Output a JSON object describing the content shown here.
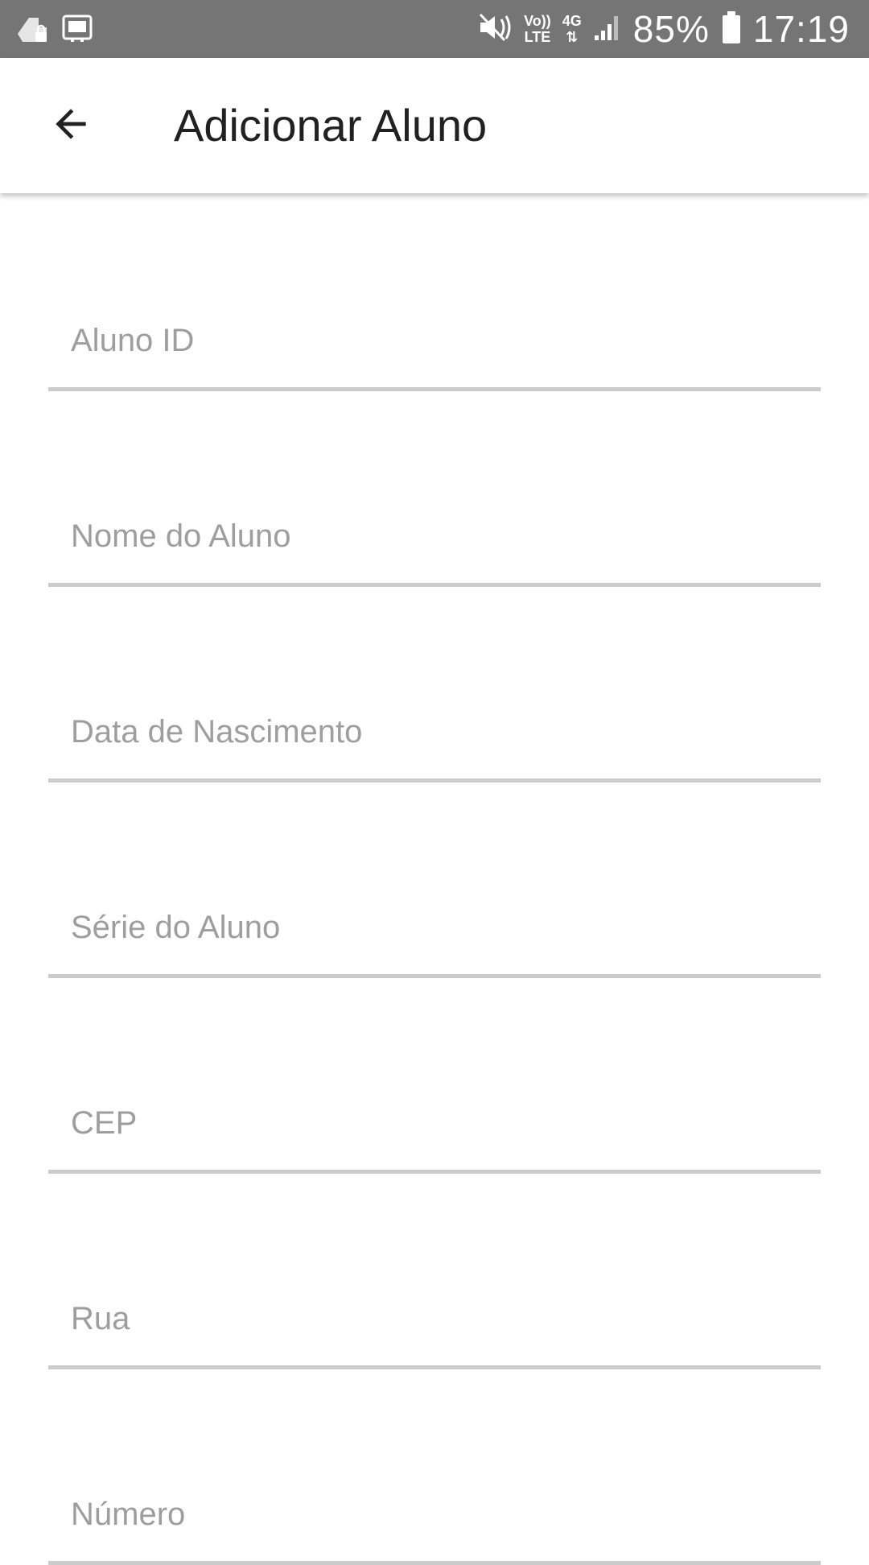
{
  "status_bar": {
    "left_icons": [
      "notification-app-icon",
      "screenshot-icon"
    ],
    "lte_top": "Vo))",
    "lte_bottom": "LTE",
    "network_type": "4G",
    "network_arrows": "⇅",
    "battery_percent": "85%",
    "time": "17:19"
  },
  "app_bar": {
    "back_icon": "arrow-back-icon",
    "title": "Adicionar Aluno"
  },
  "form": {
    "fields": [
      {
        "placeholder": "Aluno ID",
        "value": ""
      },
      {
        "placeholder": "Nome do Aluno",
        "value": ""
      },
      {
        "placeholder": "Data de Nascimento",
        "value": ""
      },
      {
        "placeholder": "Série do Aluno",
        "value": ""
      },
      {
        "placeholder": "CEP",
        "value": ""
      },
      {
        "placeholder": "Rua",
        "value": ""
      },
      {
        "placeholder": "Número",
        "value": ""
      }
    ]
  }
}
